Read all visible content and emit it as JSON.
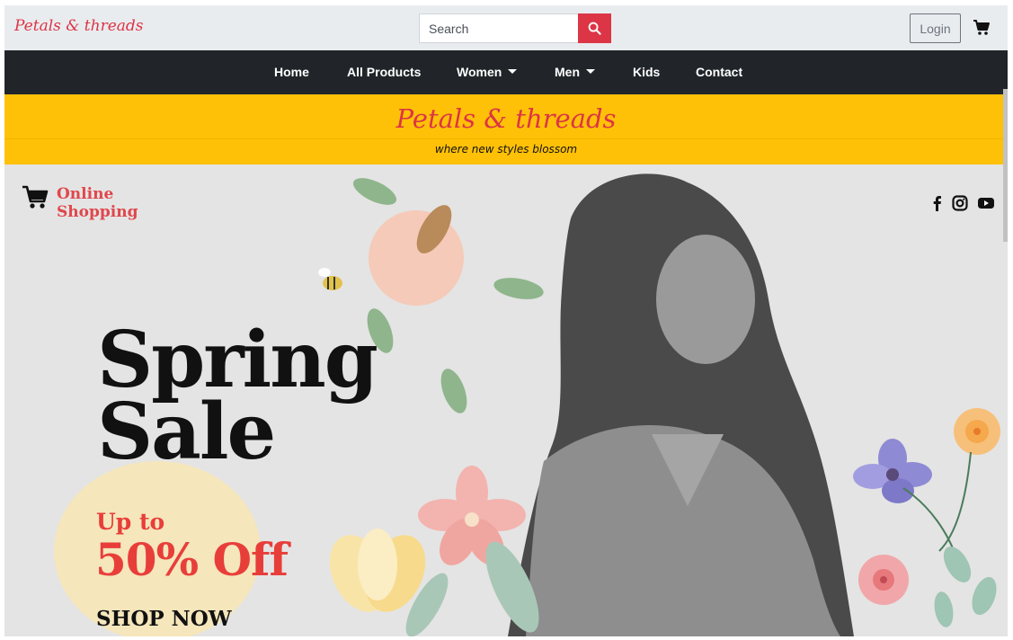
{
  "topbar": {
    "brand": "Petals & threads",
    "search_placeholder": "Search",
    "login_label": "Login"
  },
  "nav": {
    "items": [
      {
        "label": "Home",
        "dropdown": false
      },
      {
        "label": "All Products",
        "dropdown": false
      },
      {
        "label": "Women",
        "dropdown": true
      },
      {
        "label": "Men",
        "dropdown": true
      },
      {
        "label": "Kids",
        "dropdown": false
      },
      {
        "label": "Contact",
        "dropdown": false
      }
    ]
  },
  "banner": {
    "title": "Petals & threads",
    "tagline": "where new styles blossom"
  },
  "hero": {
    "online_line1": "Online",
    "online_line2": "Shopping",
    "headline_line1": "Spring",
    "headline_line2": "Sale",
    "upto": "Up to",
    "discount": "50% Off",
    "cta": "SHOP NOW",
    "social_icons": [
      "facebook-icon",
      "instagram-icon",
      "youtube-icon"
    ]
  },
  "colors": {
    "brand_red": "#dc3545",
    "nav_dark": "#212529",
    "banner_yellow": "#ffc107",
    "sale_red": "#e83e3a"
  }
}
